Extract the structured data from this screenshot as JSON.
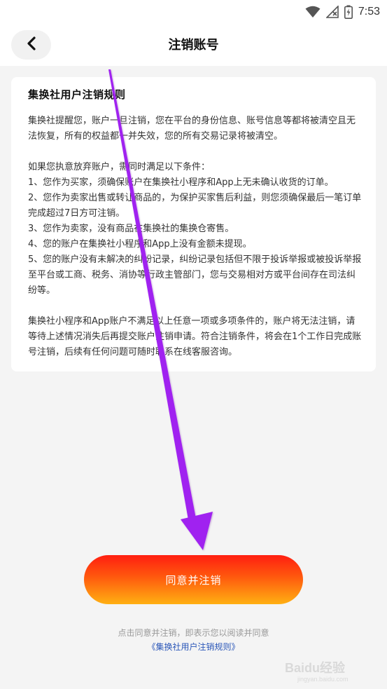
{
  "status_bar": {
    "time": "7:53",
    "icons": [
      "wifi-icon",
      "signal-icon",
      "battery-icon"
    ]
  },
  "nav": {
    "back_icon": "chevron-left-icon",
    "title": "注销账号"
  },
  "rules": {
    "title": "集换社用户注销规则",
    "intro": "集换社提醒您，账户一旦注销，您在平台的身份信息、账号信息等都将被清空且无法恢复，所有的权益都一并失效，您的所有交易记录将被清空。",
    "condition_lead": "如果您执意放弃账户，需同时满足以下条件：",
    "conditions": [
      "1、您作为买家，须确保账户在集换社小程序和App上无未确认收货的订单。",
      "2、您作为卖家出售或转让商品的，为保护买家售后利益，则您须确保最后一笔订单完成超过7日方可注销。",
      "3、您作为卖家，没有商品在集换社的集换仓寄售。",
      "4、您的账户在集换社小程序和App上没有金额未提现。",
      "5、您的账户没有未解决的纠纷记录，纠纷记录包括但不限于投诉举报或被投诉举报至平台或工商、税务、消协等行政主管部门，您与交易相对方或平台间存在司法纠纷等。"
    ],
    "closing": "集换社小程序和App账户不满足以上任意一项或多项条件的，账户将无法注销，请等待上述情况消失后再提交账户注销申请。符合注销条件，将会在1个工作日完成账号注销，后续有任何问题可随时联系在线客服咨询。"
  },
  "actions": {
    "agree_label": "同意并注销"
  },
  "footer": {
    "note": "点击同意并注销，即表示您以阅读并同意",
    "link": "《集换社用户注销规则》"
  },
  "colors": {
    "button_gradient": [
      "#ff1e10",
      "#ff5a0e",
      "#ffb012"
    ],
    "link": "#2a56b8",
    "annotation_arrow": "#9b1aef"
  },
  "watermark": {
    "text": "Baidu经验",
    "subtext": "jingyan.baidu.com"
  }
}
